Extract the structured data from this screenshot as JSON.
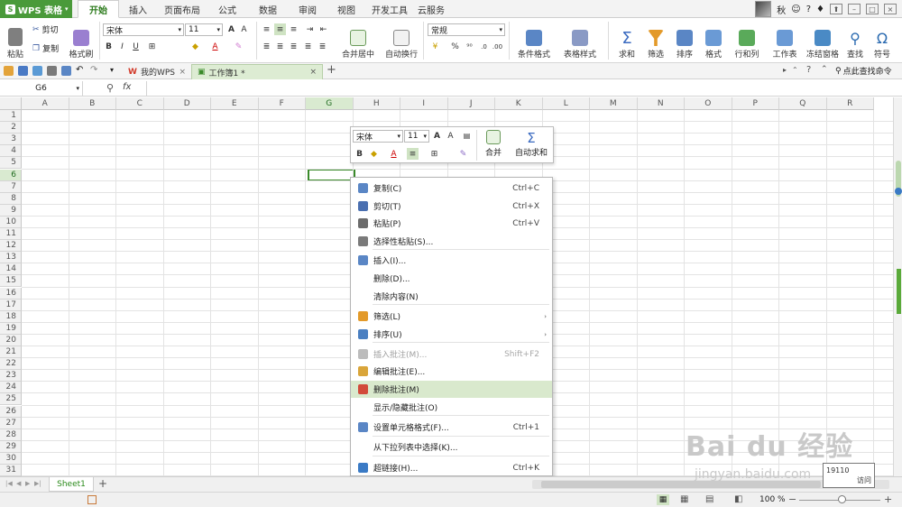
{
  "app": {
    "name": "WPS 表格"
  },
  "menu_tabs": [
    "开始",
    "插入",
    "页面布局",
    "公式",
    "数据",
    "审阅",
    "视图",
    "开发工具",
    "云服务"
  ],
  "user": {
    "name": "秋"
  },
  "ribbon": {
    "paste": "粘贴",
    "cut": "剪切",
    "copy": "复制",
    "format_painter": "格式刷",
    "font_name": "宋体",
    "font_size": "11",
    "merge_center": "合并居中",
    "wrap_text": "自动换行",
    "number_format": "常规",
    "cond_format": "条件格式",
    "table_style": "表格样式",
    "sum": "求和",
    "filter": "筛选",
    "sort": "排序",
    "format": "格式",
    "row_col": "行和列",
    "worksheet": "工作表",
    "freeze": "冻结窗格",
    "find": "查找",
    "symbol": "符号"
  },
  "toolbar": {
    "tabs": [
      {
        "label": "我的WPS"
      },
      {
        "label": "工作簿1 *"
      }
    ],
    "search": "点此查找命令"
  },
  "formula": {
    "namebox": "G6",
    "fx": "fx",
    "value": ""
  },
  "grid": {
    "columns": [
      "A",
      "B",
      "C",
      "D",
      "E",
      "F",
      "G",
      "H",
      "I",
      "J",
      "K",
      "L",
      "M",
      "N",
      "O",
      "P",
      "Q",
      "R"
    ],
    "rows": [
      "1",
      "2",
      "3",
      "4",
      "5",
      "6",
      "7",
      "8",
      "9",
      "10",
      "11",
      "12",
      "13",
      "14",
      "15",
      "16",
      "17",
      "18",
      "19",
      "20",
      "21",
      "22",
      "23",
      "24",
      "25",
      "26",
      "27",
      "28",
      "29",
      "30",
      "31"
    ],
    "selected_col": "G",
    "selected_row": "6"
  },
  "mini_toolbar": {
    "font": "宋体",
    "size": "11",
    "bold": "B",
    "merge": "合并",
    "autosum": "自动求和"
  },
  "context_menu": [
    {
      "label": "复制(C)",
      "shortcut": "Ctrl+C",
      "icon": "copy-icon",
      "color": "#5a86c5"
    },
    {
      "label": "剪切(T)",
      "shortcut": "Ctrl+X",
      "icon": "scissors-icon",
      "color": "#4a6fb0"
    },
    {
      "label": "粘贴(P)",
      "shortcut": "Ctrl+V",
      "icon": "paste-icon",
      "color": "#6b6b6b"
    },
    {
      "label": "选择性粘贴(S)...",
      "shortcut": "",
      "icon": "paste-special-icon",
      "color": "#7a7a7a"
    },
    {
      "label": "插入(I)...",
      "shortcut": "",
      "icon": "insert-icon",
      "color": "#5a86c5"
    },
    {
      "label": "删除(D)...",
      "shortcut": "",
      "icon": "",
      "color": ""
    },
    {
      "label": "清除内容(N)",
      "shortcut": "",
      "icon": "",
      "color": ""
    },
    {
      "label": "筛选(L)",
      "shortcut": "",
      "icon": "filter-icon",
      "color": "#e39a2a",
      "submenu": "›"
    },
    {
      "label": "排序(U)",
      "shortcut": "",
      "icon": "sort-icon",
      "color": "#4a7fc1",
      "submenu": "›"
    },
    {
      "label": "插入批注(M)...",
      "shortcut": "Shift+F2",
      "icon": "insert-comment-icon",
      "color": "#bcbcbc"
    },
    {
      "label": "编辑批注(E)...",
      "shortcut": "",
      "icon": "edit-comment-icon",
      "color": "#d9a53a"
    },
    {
      "label": "删除批注(M)",
      "shortcut": "",
      "icon": "delete-comment-icon",
      "color": "#d24a3a"
    },
    {
      "label": "显示/隐藏批注(O)",
      "shortcut": "",
      "icon": "",
      "color": ""
    },
    {
      "label": "设置单元格格式(F)...",
      "shortcut": "Ctrl+1",
      "icon": "format-cells-icon",
      "color": "#5a86c5"
    },
    {
      "label": "从下拉列表中选择(K)...",
      "shortcut": "",
      "icon": "",
      "color": ""
    },
    {
      "label": "超链接(H)...",
      "shortcut": "Ctrl+K",
      "icon": "hyperlink-icon",
      "color": "#3a7ac5"
    }
  ],
  "sheets": [
    {
      "name": "Sheet1"
    }
  ],
  "sheet_add": "+",
  "status": {
    "zoom": "100 %"
  },
  "watermark": {
    "brand": "Bai du 经验",
    "url": "jingyan.baidu.com"
  },
  "tooltip": {
    "line1": "19110",
    "line2": "访问"
  },
  "colors": {
    "accent": "#4a9a3a",
    "highlight": "#d9e9cd",
    "selection": "#3a8a2a"
  }
}
